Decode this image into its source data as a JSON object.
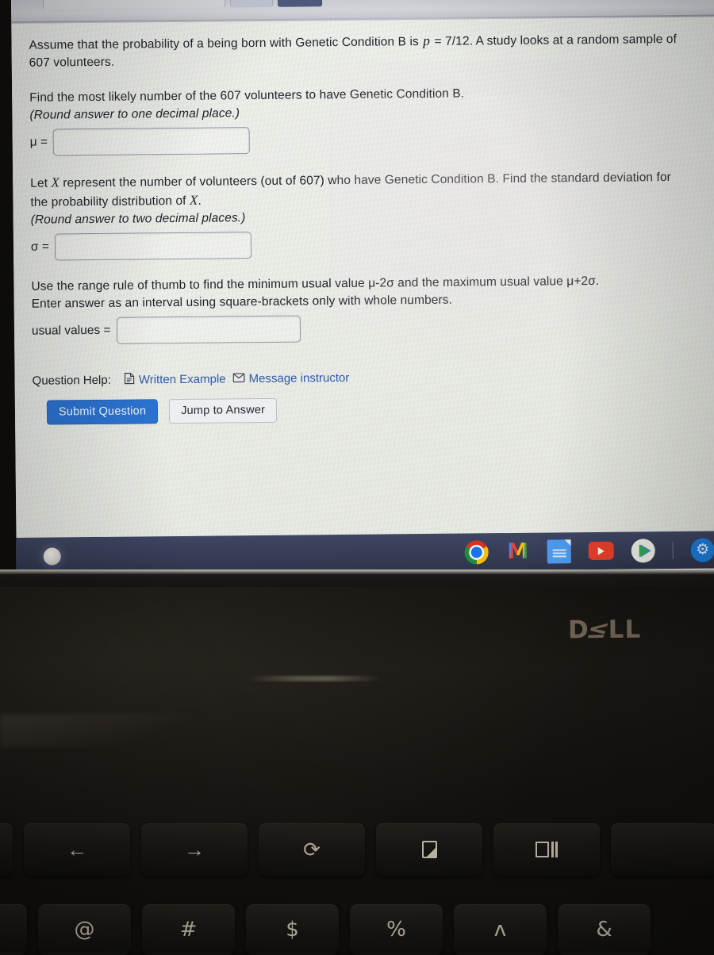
{
  "browser": {
    "tabs": [
      "tab-inactive-wide",
      "tab-inactive",
      "tab-active"
    ]
  },
  "question": {
    "intro_part1": "Assume that the probability of a being born with Genetic Condition B is ",
    "intro_p_symbol": "p",
    "intro_p_value": " = 7/12.",
    "intro_part2": " A study looks at a random sample of 607 volunteers.",
    "part1": {
      "prompt": "Find the most likely number of the 607 volunteers to have Genetic Condition B.",
      "rounding": "(Round answer to one decimal place.)",
      "field_label": "μ =",
      "field_value": "",
      "field_placeholder": ""
    },
    "part2": {
      "prompt_a": "Let ",
      "prompt_var": "X",
      "prompt_b": " represent the number of volunteers (out of 607) who have Genetic Condition B. Find the standard deviation for the probability distribution of ",
      "prompt_var2": "X",
      "prompt_c": ".",
      "rounding": "(Round answer to two decimal places.)",
      "field_label": "σ =",
      "field_value": "",
      "field_placeholder": ""
    },
    "part3": {
      "prompt_line1": "Use the range rule of thumb to find the minimum usual value μ-2σ and the maximum usual value μ+2σ.",
      "prompt_line2": "Enter answer as an interval using square-brackets only with whole numbers.",
      "field_label": "usual values =",
      "field_value": "",
      "field_placeholder": ""
    }
  },
  "help": {
    "label": "Question Help:",
    "written_example": "Written Example",
    "written_example_icon": "document-icon",
    "message_instructor": "Message instructor",
    "message_instructor_icon": "envelope-icon"
  },
  "actions": {
    "submit": "Submit Question",
    "jump": "Jump to Answer"
  },
  "shelf": {
    "launcher_icon": "launcher-circle-icon",
    "items": [
      {
        "name": "chrome-icon",
        "label": "Chrome"
      },
      {
        "name": "gmail-icon",
        "label": "M"
      },
      {
        "name": "google-docs-icon",
        "label": "Docs"
      },
      {
        "name": "youtube-icon",
        "label": "YouTube"
      },
      {
        "name": "play-store-icon",
        "label": "Play Store"
      },
      {
        "name": "settings-icon",
        "label": "⚙"
      }
    ]
  },
  "laptop": {
    "brand_d": "D",
    "brand_e": "≤",
    "brand_ll": "LL"
  },
  "keyboard": {
    "function_row": [
      {
        "name": "key-edge-left",
        "glyph": ""
      },
      {
        "name": "key-back",
        "glyph": "←"
      },
      {
        "name": "key-forward",
        "glyph": "→"
      },
      {
        "name": "key-reload",
        "glyph": "⟳"
      },
      {
        "name": "key-fullscreen",
        "glyph": ""
      },
      {
        "name": "key-overview",
        "glyph": ""
      },
      {
        "name": "key-brightness",
        "glyph": ""
      }
    ],
    "number_row": [
      {
        "name": "key-edge-left-num",
        "glyph": "!"
      },
      {
        "name": "key-at",
        "glyph": "@"
      },
      {
        "name": "key-hash",
        "glyph": "#"
      },
      {
        "name": "key-dollar",
        "glyph": "$"
      },
      {
        "name": "key-percent",
        "glyph": "%"
      },
      {
        "name": "key-caret",
        "glyph": "ʌ"
      },
      {
        "name": "key-ampersand",
        "glyph": "&"
      }
    ]
  },
  "colors": {
    "primary_button": "#2b72d0",
    "link": "#2f58a8",
    "shelf": "#3e4662",
    "page_bg": "#ebede6",
    "dell_logo": "#7d6f5d"
  }
}
